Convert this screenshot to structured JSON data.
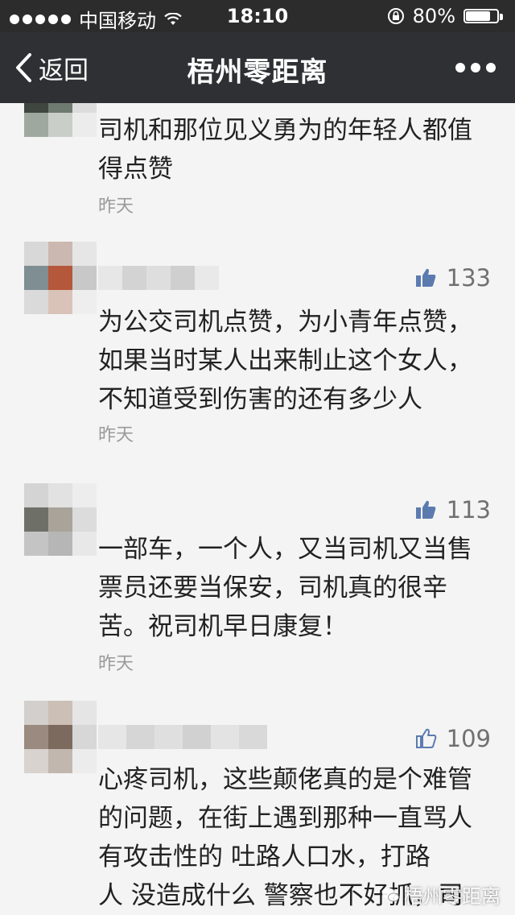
{
  "status_bar": {
    "carrier": "中国移动",
    "time": "18:10",
    "battery_percent": "80%",
    "battery_level": 0.8
  },
  "nav": {
    "back_label": "返回",
    "title": "梧州零距离"
  },
  "comments": [
    {
      "likes": "",
      "text": "司机和那位见义勇为的年轻人都值\n得点赞",
      "time": "昨天"
    },
    {
      "likes": "133",
      "text": "为公交司机点赞，为小青年点赞，\n如果当时某人出来制止这个女人，\n不知道受到伤害的还有多少人",
      "time": "昨天"
    },
    {
      "likes": "113",
      "text": "一部车，一个人，又当司机又当售\n票员还要当保安，司机真的很辛\n苦。祝司机早日康复！",
      "time": "昨天"
    },
    {
      "likes": "109",
      "text": "心疼司机，这些颠佬真的是个难管\n的问题，在街上遇到那种一直骂人\n有攻击性的 吐路人口水，打路\n人 没造成什么  警察也不好抓，司",
      "time": ""
    }
  ],
  "watermark": "梧州零距离",
  "icons": {
    "back": "chevron-left-icon",
    "more": "more-dots-icon",
    "like": "thumbs-up-icon",
    "wifi": "wifi-icon",
    "lock": "rotation-lock-icon",
    "battery": "battery-icon"
  },
  "colors": {
    "status_bar": "#2c2c2c",
    "nav_bar": "#2e3033",
    "background": "#f4f4f4",
    "like_icon": "#5b7bb0",
    "secondary_text": "#9a9a9a"
  }
}
